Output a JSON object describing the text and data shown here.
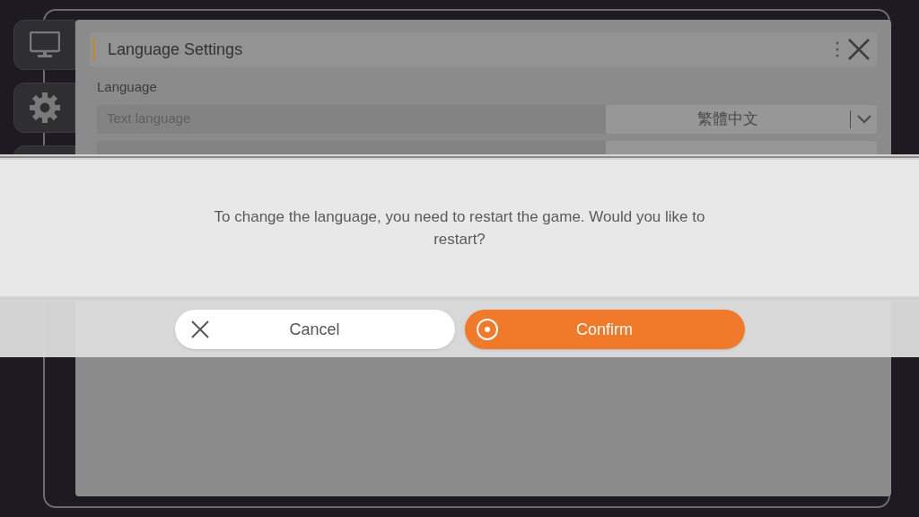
{
  "panel": {
    "title": "Language Settings",
    "section": "Language",
    "rows": [
      {
        "label": "Text language",
        "value": "繁體中文"
      }
    ]
  },
  "dialog": {
    "message": "To change the language, you need to restart the game. Would you like to restart?",
    "buttons": [
      {
        "label": "Cancel",
        "kind": "cancel"
      },
      {
        "label": "Confirm",
        "kind": "confirm"
      }
    ]
  }
}
